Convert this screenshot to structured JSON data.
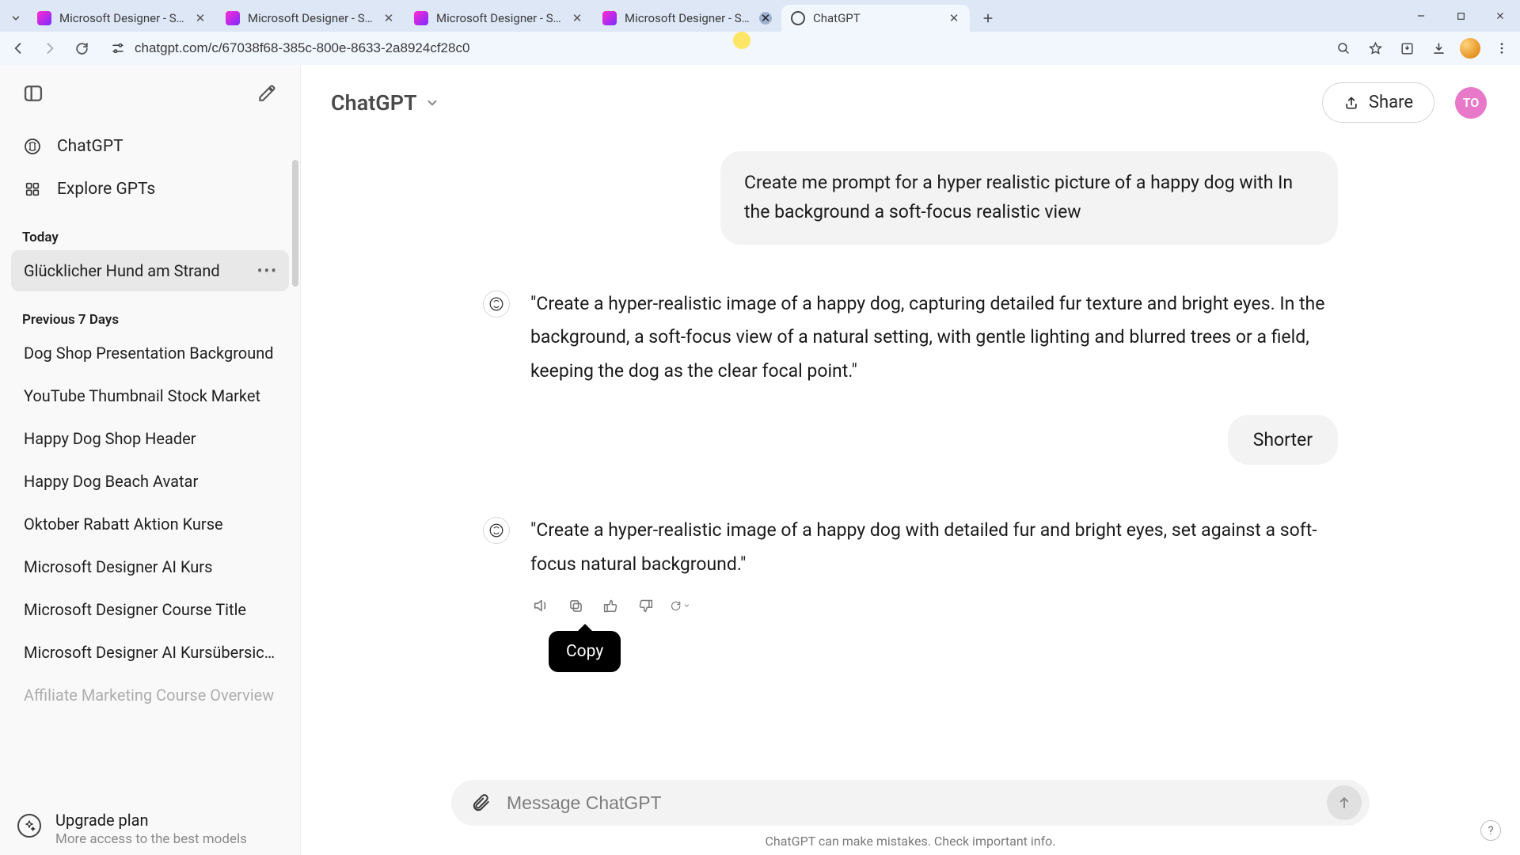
{
  "browser": {
    "tabs": [
      {
        "title": "Microsoft Designer - Stunning",
        "kind": "designer"
      },
      {
        "title": "Microsoft Designer - Stunning",
        "kind": "designer"
      },
      {
        "title": "Microsoft Designer - Stunning",
        "kind": "designer"
      },
      {
        "title": "Microsoft Designer - Stunning",
        "kind": "designer",
        "hover_close": true
      },
      {
        "title": "ChatGPT",
        "kind": "chatgpt",
        "active": true
      }
    ],
    "omnibox_url": "chatgpt.com/c/67038f68-385c-800e-8633-2a8924cf28c0"
  },
  "sidebar": {
    "nav": [
      {
        "label": "ChatGPT",
        "icon": "chatgpt-logo-icon"
      },
      {
        "label": "Explore GPTs",
        "icon": "grid-icon"
      }
    ],
    "sections": [
      {
        "title": "Today",
        "items": [
          {
            "label": "Glücklicher Hund am Strand",
            "active": true
          }
        ]
      },
      {
        "title": "Previous 7 Days",
        "items": [
          {
            "label": "Dog Shop Presentation Background"
          },
          {
            "label": "YouTube Thumbnail Stock Market"
          },
          {
            "label": "Happy Dog Shop Header"
          },
          {
            "label": "Happy Dog Beach Avatar"
          },
          {
            "label": "Oktober Rabatt Aktion Kurse"
          },
          {
            "label": "Microsoft Designer AI Kurs"
          },
          {
            "label": "Microsoft Designer Course Title"
          },
          {
            "label": "Microsoft Designer AI Kursübersicht"
          },
          {
            "label": "Affiliate Marketing Course Overview"
          }
        ]
      }
    ],
    "upgrade": {
      "title": "Upgrade plan",
      "subtitle": "More access to the best models"
    }
  },
  "header": {
    "model_label": "ChatGPT",
    "share_label": "Share",
    "user_initials": "TO"
  },
  "conversation": {
    "user_msg1": "Create me prompt for a hyper realistic picture of a happy dog with In the background a soft-focus realistic view",
    "assistant_msg1": "\"Create a hyper-realistic image of a happy dog, capturing detailed fur texture and bright eyes. In the background, a soft-focus view of a natural setting, with gentle lighting and blurred trees or a field, keeping the dog as the clear focal point.\"",
    "user_msg2": "Shorter",
    "assistant_msg2": "\"Create a hyper-realistic image of a happy dog with detailed fur and bright eyes, set against a soft-focus natural background.\"",
    "copy_tooltip": "Copy"
  },
  "composer": {
    "placeholder": "Message ChatGPT"
  },
  "footer": {
    "disclaimer": "ChatGPT can make mistakes. Check important info."
  }
}
